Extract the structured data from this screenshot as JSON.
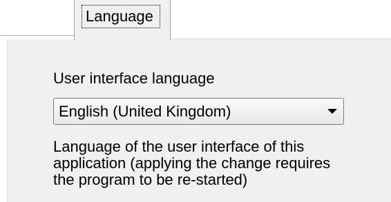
{
  "tabs": {
    "active_label": "Language"
  },
  "language_panel": {
    "ui_language_label": "User interface language",
    "selected_language": "English (United Kingdom)",
    "description_lines": [
      "Language of the user interface of this",
      "application (applying the change requires",
      "the program to be re-started)"
    ]
  },
  "icons": {
    "dropdown": "chevron-down-icon"
  },
  "colors": {
    "panel_background": "#f0f0f0",
    "page_background": "#ffffff",
    "text": "#000000",
    "border": "#7a7a7a"
  }
}
